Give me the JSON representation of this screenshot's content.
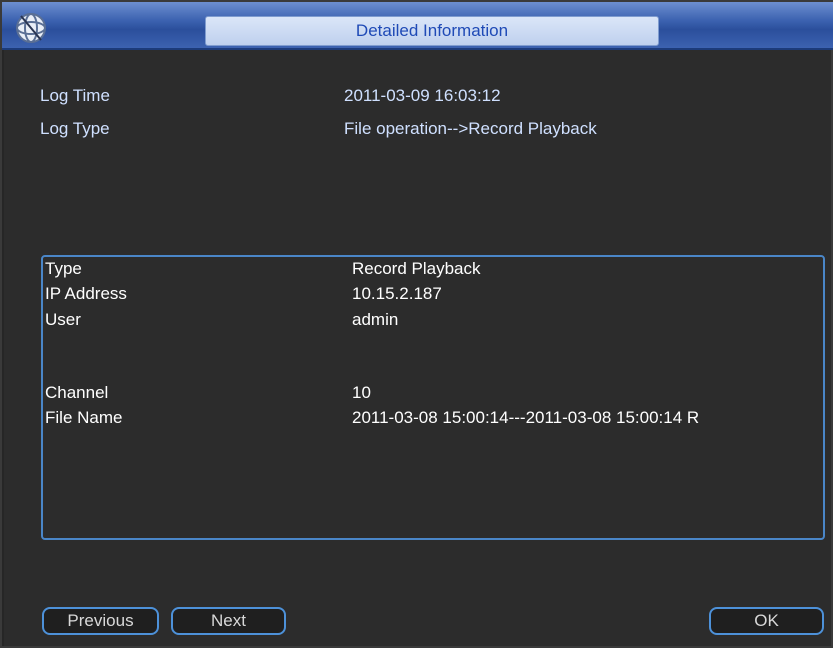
{
  "window": {
    "title": "Detailed Information",
    "logo_icon": "dvr-logo-icon"
  },
  "summary": {
    "log_time_label": "Log Time",
    "log_time_value": "2011-03-09 16:03:12",
    "log_type_label": "Log Type",
    "log_type_value": "File operation-->Record Playback"
  },
  "details": {
    "type_label": "Type",
    "type_value": "Record Playback",
    "ip_label": "IP Address",
    "ip_value": "10.15.2.187",
    "user_label": "User",
    "user_value": "admin",
    "channel_label": "Channel",
    "channel_value": "10",
    "file_label": "File Name",
    "file_value": "2011-03-08 15:00:14---2011-03-08 15:00:14 R"
  },
  "buttons": {
    "previous": "Previous",
    "next": "Next",
    "ok": "OK"
  },
  "colors": {
    "accent": "#4d91d9",
    "title_text": "#1f4ab6"
  }
}
